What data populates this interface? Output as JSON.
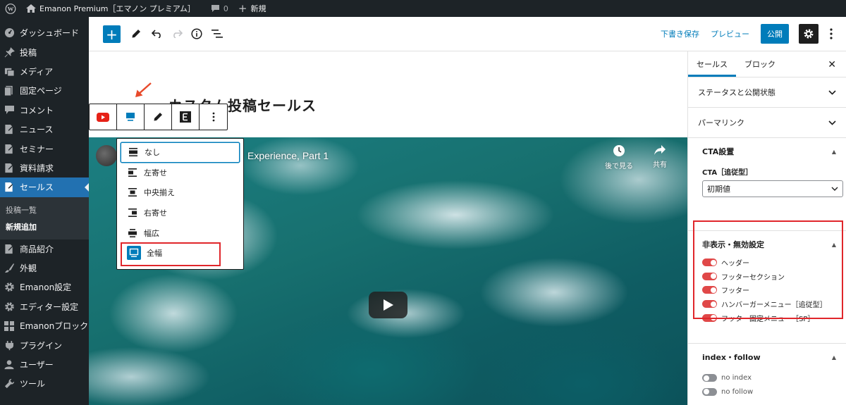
{
  "admin_bar": {
    "site_name": "Emanon Premium［エマノン プレミアム］",
    "comment_count": "0",
    "new_label": "新規"
  },
  "sidebar": {
    "items": [
      {
        "label": "ダッシュボード",
        "icon": "dashboard-icon"
      },
      {
        "label": "投稿",
        "icon": "pin-icon"
      },
      {
        "label": "メディア",
        "icon": "media-icon"
      },
      {
        "label": "固定ページ",
        "icon": "page-icon"
      },
      {
        "label": "コメント",
        "icon": "comment-icon"
      },
      {
        "label": "ニュース",
        "icon": "post-icon"
      },
      {
        "label": "セミナー",
        "icon": "post-icon"
      },
      {
        "label": "資料請求",
        "icon": "post-icon"
      },
      {
        "label": "セールス",
        "icon": "post-icon",
        "current": true
      },
      {
        "label": "商品紹介",
        "icon": "post-icon"
      },
      {
        "label": "外観",
        "icon": "appearance-icon"
      },
      {
        "label": "Emanon設定",
        "icon": "gear-icon"
      },
      {
        "label": "エディター設定",
        "icon": "gear-icon"
      },
      {
        "label": "Emanonブロック",
        "icon": "blocks-icon"
      },
      {
        "label": "プラグイン",
        "icon": "plugin-icon"
      },
      {
        "label": "ユーザー",
        "icon": "user-icon"
      },
      {
        "label": "ツール",
        "icon": "wrench-icon"
      }
    ],
    "submenu": [
      "投稿一覧",
      "新規追加"
    ]
  },
  "header": {
    "save_draft": "下書き保存",
    "preview": "プレビュー",
    "publish": "公開"
  },
  "post": {
    "title": "カスタム投稿セールス"
  },
  "video": {
    "title": "Experience, Part 1",
    "watch_later": "後で見る",
    "share": "共有"
  },
  "alignment_menu": {
    "options": [
      "なし",
      "左寄せ",
      "中央揃え",
      "右寄せ",
      "幅広",
      "全幅"
    ]
  },
  "settings_panel": {
    "tab_post": "セールス",
    "tab_block": "ブロック",
    "status_visibility": "ステータスと公開状態",
    "permalink": "パーマリンク",
    "cta": {
      "heading": "CTA設置",
      "field_label": "CTA［追従型］",
      "select_value": "初期値"
    },
    "hide_disable": {
      "heading": "非表示・無効設定",
      "toggles": [
        "ヘッダー",
        "フッターセクション",
        "フッター",
        "ハンバーガーメニュー［追従型］",
        "フッター固定メニュー［SP］"
      ]
    },
    "index_follow": {
      "heading": "index・follow",
      "toggles": [
        "no index",
        "no follow"
      ]
    }
  },
  "colors": {
    "accent": "#007cba",
    "admin_bg": "#1d2327",
    "highlight": "#e0262b",
    "toggle_on": "#e04848"
  }
}
